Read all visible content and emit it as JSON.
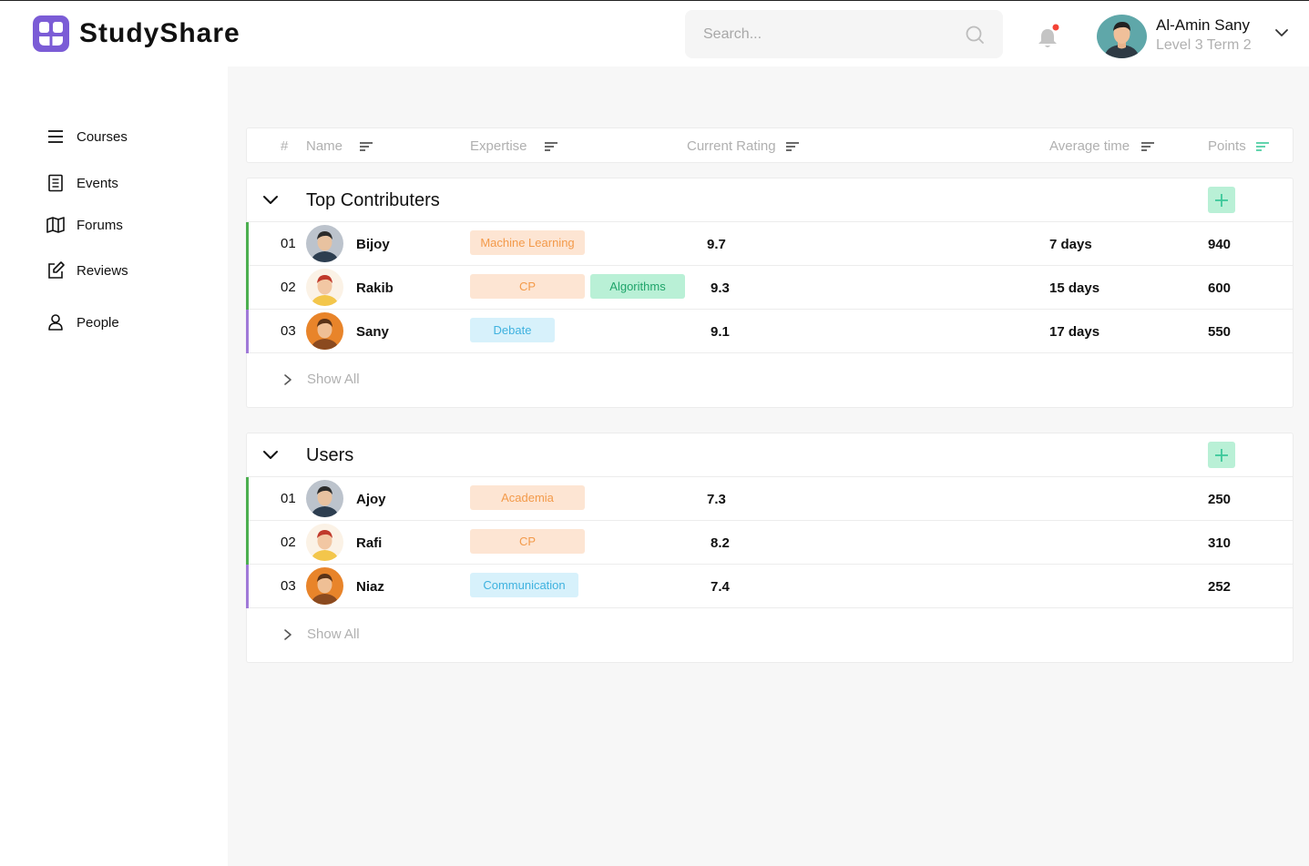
{
  "app": {
    "name": "StudyShare"
  },
  "search": {
    "placeholder": "Search..."
  },
  "user": {
    "name": "Al-Amin Sany",
    "level": "Level 3 Term 2"
  },
  "sidebar": {
    "items": [
      {
        "label": "Courses",
        "icon": "menu-icon"
      },
      {
        "label": "Events",
        "icon": "document-icon"
      },
      {
        "label": "Forums",
        "icon": "map-icon"
      },
      {
        "label": "Reviews",
        "icon": "edit-icon"
      },
      {
        "label": "People",
        "icon": "person-icon"
      }
    ]
  },
  "columns": {
    "hash": "#",
    "name": "Name",
    "expertise": "Expertise",
    "rating": "Current Rating",
    "avg_time": "Average time",
    "points": "Points"
  },
  "colors": {
    "brand": "#7b5cd6",
    "accent_green": "#1fa46a",
    "bar_green": "#4caf50",
    "bar_purple": "#a07ad8",
    "notification": "#f44336"
  },
  "sections": [
    {
      "title": "Top Contributers",
      "show_all": "Show All",
      "rows": [
        {
          "index": "01",
          "name": "Bijoy",
          "tags": [
            {
              "label": "Machine Learning",
              "color": "orange"
            }
          ],
          "rating": "9.7",
          "avg_time": "7 days",
          "points": "940",
          "bar": "green"
        },
        {
          "index": "02",
          "name": "Rakib",
          "tags": [
            {
              "label": "CP",
              "color": "orange"
            },
            {
              "label": "Algorithms",
              "color": "green"
            }
          ],
          "rating": "9.3",
          "avg_time": "15 days",
          "points": "600",
          "bar": "green"
        },
        {
          "index": "03",
          "name": "Sany",
          "tags": [
            {
              "label": "Debate",
              "color": "blue"
            }
          ],
          "rating": "9.1",
          "avg_time": "17 days",
          "points": "550",
          "bar": "purple"
        }
      ]
    },
    {
      "title": "Users",
      "show_all": "Show All",
      "rows": [
        {
          "index": "01",
          "name": "Ajoy",
          "tags": [
            {
              "label": "Academia",
              "color": "orange"
            }
          ],
          "rating": "7.3",
          "avg_time": "",
          "points": "250",
          "bar": "green"
        },
        {
          "index": "02",
          "name": "Rafi",
          "tags": [
            {
              "label": "CP",
              "color": "orange"
            }
          ],
          "rating": "8.2",
          "avg_time": "",
          "points": "310",
          "bar": "green"
        },
        {
          "index": "03",
          "name": "Niaz",
          "tags": [
            {
              "label": "Communication",
              "color": "blue"
            }
          ],
          "rating": "7.4",
          "avg_time": "",
          "points": "252",
          "bar": "purple"
        }
      ]
    }
  ]
}
